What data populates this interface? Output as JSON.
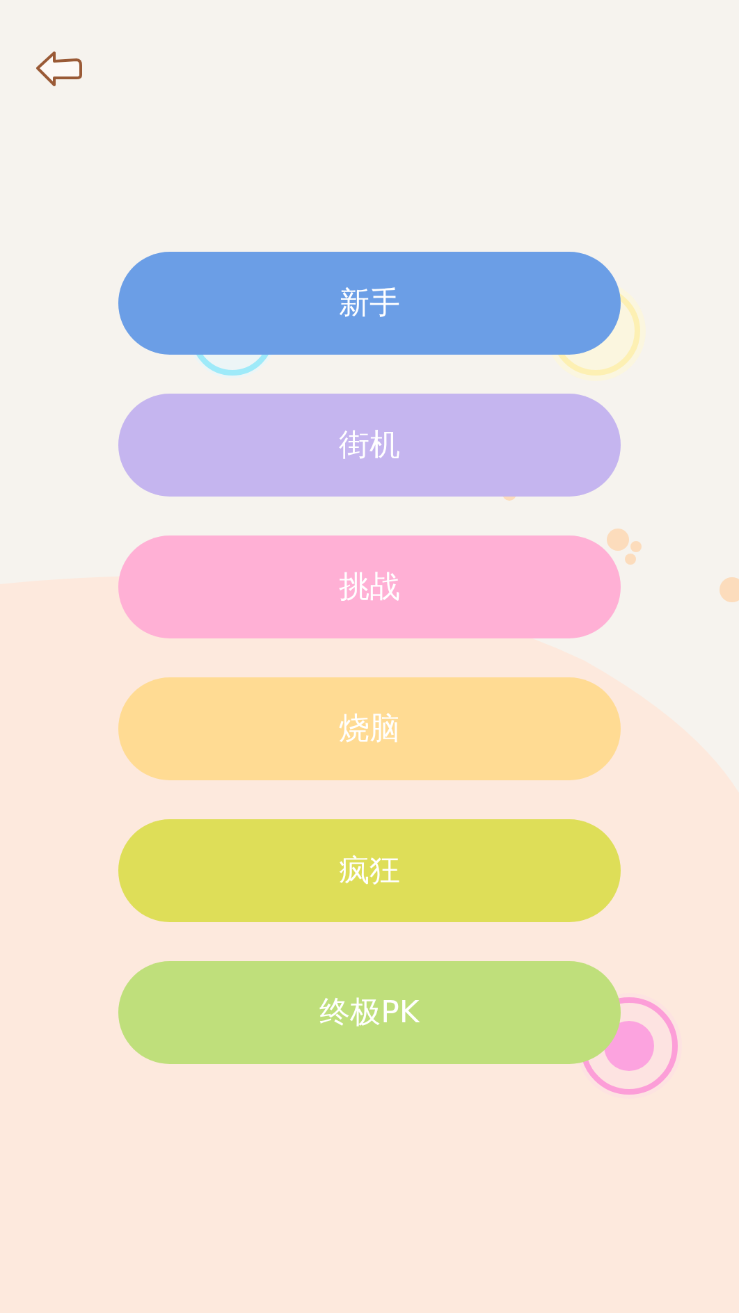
{
  "modes": [
    {
      "label": "新手",
      "color": "#6b9ee6"
    },
    {
      "label": "街机",
      "color": "#c5b5ef"
    },
    {
      "label": "挑战",
      "color": "#ffb0d5"
    },
    {
      "label": "烧脑",
      "color": "#ffdb93"
    },
    {
      "label": "疯狂",
      "color": "#dede58"
    },
    {
      "label": "终极PK",
      "color": "#bfdf7b"
    }
  ]
}
